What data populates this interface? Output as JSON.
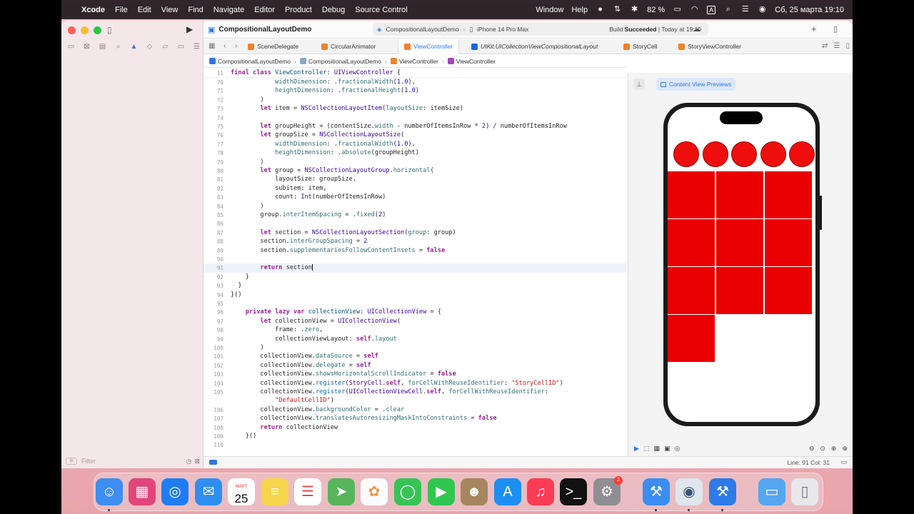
{
  "menubar": {
    "app": "Xcode",
    "items": [
      "File",
      "Edit",
      "View",
      "Find",
      "Navigate",
      "Editor",
      "Product",
      "Debug",
      "Source Control"
    ],
    "right_items": [
      "Window",
      "Help"
    ],
    "battery": "82 %",
    "keyboard": "A",
    "datetime": "Сб, 25 марта  19:10"
  },
  "toolbar": {
    "project_title": "CompositionalLayoutDemo",
    "scheme": "CompositionalLayoutDemo",
    "device": "iPhone 14 Pro Max",
    "status_prefix": "Build",
    "status_bold": "Succeeded",
    "status_suffix": "| Today at 19:10"
  },
  "tabs": [
    {
      "label": "SceneDelegate",
      "color": "#f0822a"
    },
    {
      "label": "CircularAnimator",
      "color": "#f0822a"
    },
    {
      "label": "ViewController",
      "color": "#f0822a",
      "active": true
    },
    {
      "label": "UIKit.UICollectionViewCompositionalLayout",
      "color": "#1a66d8",
      "italic": true
    },
    {
      "label": "StoryCell",
      "color": "#f0822a"
    },
    {
      "label": "StoryViewController",
      "color": "#f0822a"
    }
  ],
  "breadcrumb": [
    "CompositionalLayoutDemo",
    "CompositionalLayoutDemo",
    "ViewController",
    "ViewController"
  ],
  "sticky_line": {
    "num": "11"
  },
  "editor": {
    "line_numbers": [
      "70",
      "71",
      "72",
      "73",
      "74",
      "75",
      "76",
      "77",
      "78",
      "79",
      "80",
      "81",
      "82",
      "83",
      "84",
      "85",
      "86",
      "87",
      "88",
      "89",
      "90",
      "91",
      "92",
      "93",
      "94",
      "95",
      "96",
      "97",
      "98",
      "99",
      "100",
      "101",
      "102",
      "103",
      "104",
      "105",
      "",
      "106",
      "107",
      "108",
      "109",
      "110"
    ],
    "current_line": "91"
  },
  "status": {
    "position": "Line: 91  Col: 31"
  },
  "canvas": {
    "preview_label": "Content View Previews",
    "story_count": 5,
    "grid": [
      [
        1,
        1,
        1
      ],
      [
        1,
        1,
        1
      ],
      [
        1,
        1,
        1
      ],
      [
        1,
        0,
        0
      ]
    ],
    "cell_color": "#ea0000"
  },
  "sidebar": {
    "filter_placeholder": "Filter"
  },
  "dock": {
    "calendar_month": "МАРТ",
    "calendar_day": "25",
    "settings_badge": "2"
  }
}
